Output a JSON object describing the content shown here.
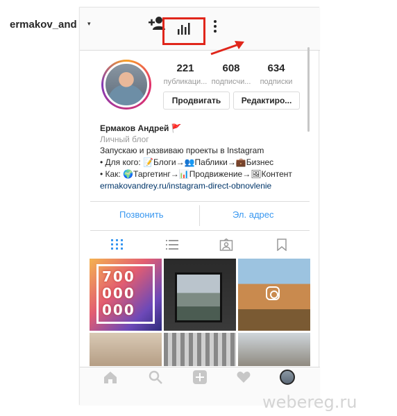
{
  "header": {
    "username": "ermakov_and",
    "caret": "▾"
  },
  "stats": [
    {
      "value": "221",
      "label": "публикаци..."
    },
    {
      "value": "608",
      "label": "подписчи..."
    },
    {
      "value": "634",
      "label": "подписки"
    }
  ],
  "buttons": {
    "promote": "Продвигать",
    "edit": "Редактиро..."
  },
  "bio": {
    "name": "Ермаков Андрей",
    "flag": "🚩",
    "category": "Личный блог",
    "line1": "Запускаю и развиваю проекты в Instagram",
    "line2": "• Для кого: 📝Блоги→👥Паблики→💼Бизнес",
    "line3": "• Как: 🌍Таргетинг→📊Продвижение→🖼Контент",
    "link": "ermakovandrey.ru/instagram-direct-obnovlenie"
  },
  "actions": {
    "call": "Позвонить",
    "email": "Эл. адрес"
  },
  "grid": {
    "post1_text": "700 000 000"
  },
  "watermark": "webereg.ru",
  "colors": {
    "highlight_box": "#e0261b",
    "link_blue": "#3897f0",
    "bio_link": "#003569"
  },
  "icons": {
    "add_user": "add-user-icon",
    "insights": "insights-bar-chart-icon",
    "more": "more-vertical-icon",
    "grid_tab": "grid-icon",
    "list_tab": "list-icon",
    "tagged_tab": "tagged-photo-icon",
    "saved_tab": "bookmark-icon",
    "home": "home-icon",
    "search": "search-icon",
    "add": "add-post-icon",
    "activity": "heart-icon",
    "profile": "profile-avatar"
  }
}
